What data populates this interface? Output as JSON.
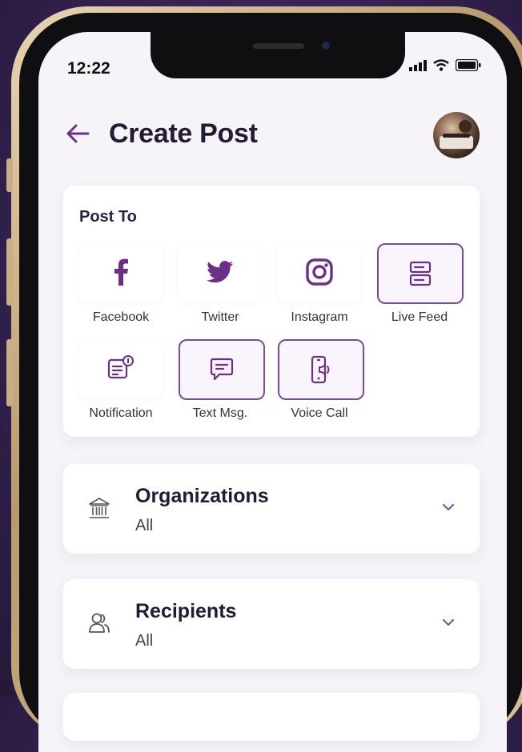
{
  "status_bar": {
    "time": "12:22"
  },
  "header": {
    "title": "Create Post"
  },
  "post_to": {
    "title": "Post To",
    "options": [
      {
        "label": "Facebook",
        "icon": "facebook-icon",
        "selected": false
      },
      {
        "label": "Twitter",
        "icon": "twitter-icon",
        "selected": false
      },
      {
        "label": "Instagram",
        "icon": "instagram-icon",
        "selected": false
      },
      {
        "label": "Live Feed",
        "icon": "live-feed-icon",
        "selected": true
      },
      {
        "label": "Notification",
        "icon": "notification-icon",
        "selected": false
      },
      {
        "label": "Text Msg.",
        "icon": "text-message-icon",
        "selected": true
      },
      {
        "label": "Voice Call",
        "icon": "voice-call-icon",
        "selected": true
      }
    ]
  },
  "organizations": {
    "label": "Organizations",
    "value": "All"
  },
  "recipients": {
    "label": "Recipients",
    "value": "All"
  },
  "colors": {
    "accent": "#7d4a9b",
    "brand_dark": "#231a33",
    "background": "#f6f4f8"
  }
}
